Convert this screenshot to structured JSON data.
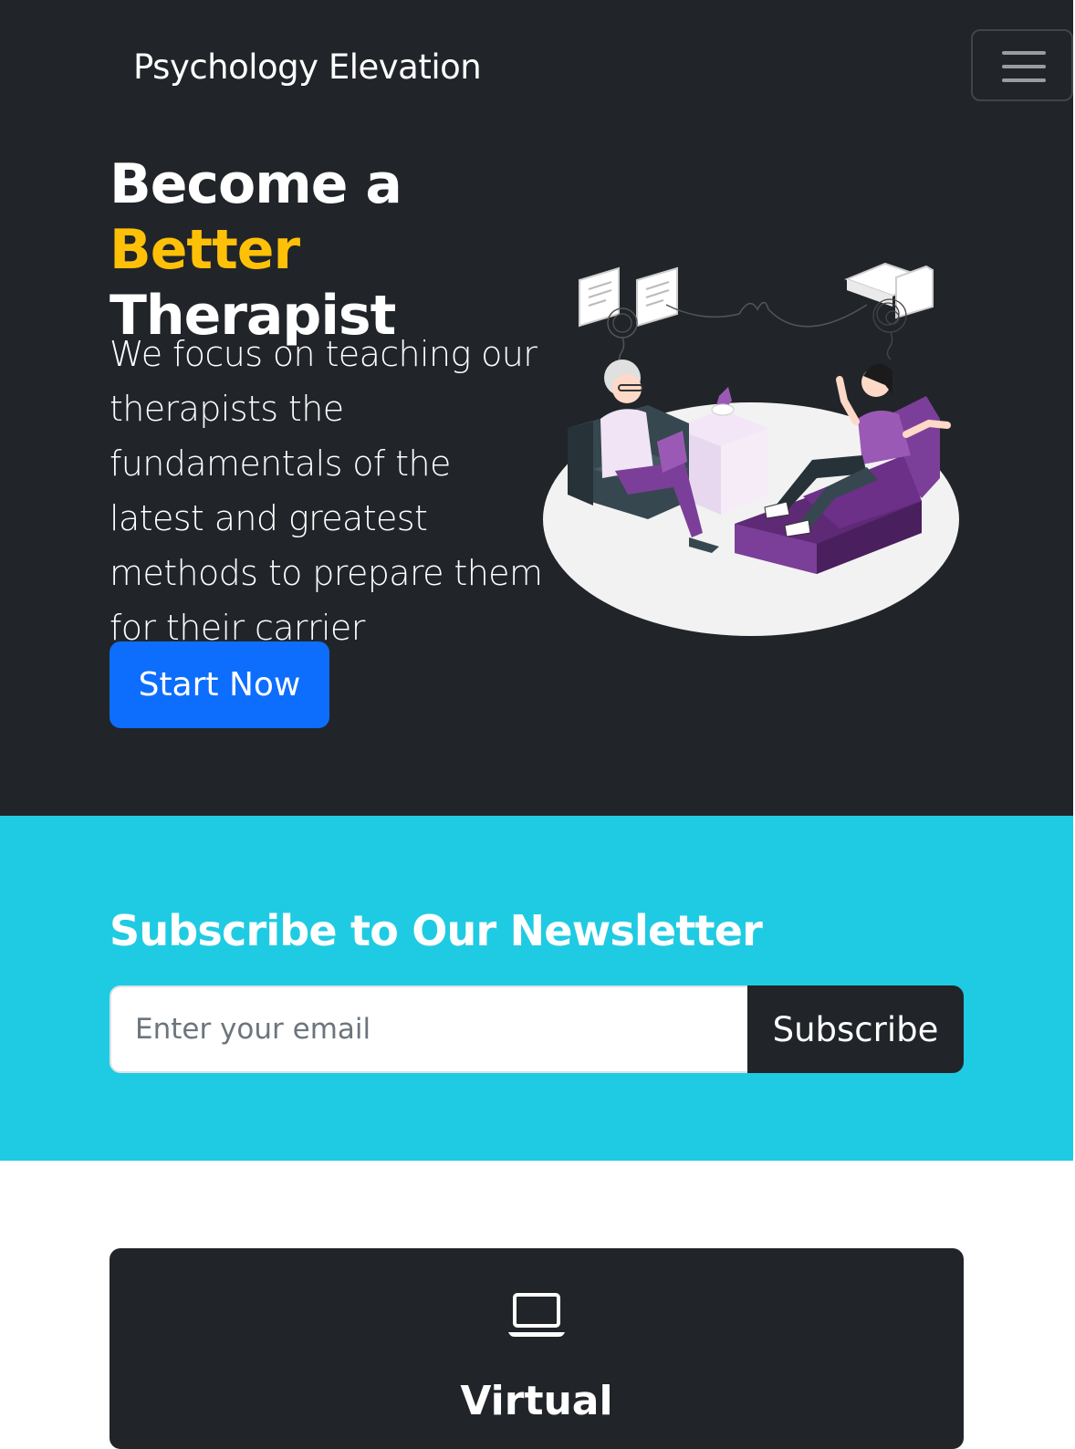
{
  "navbar": {
    "brand": "Psychology Elevation",
    "toggler_icon": "hamburger-menu-icon"
  },
  "hero": {
    "title_prefix": "Become a ",
    "title_accent": "Better",
    "title_suffix": "Therapist",
    "lead": "We focus on teaching our therapists the fundamentals of the latest and greatest methods to prepare them for their carrier",
    "cta_label": "Start Now",
    "illustration": "therapy-session-illustration",
    "accent_color": "#ffc107",
    "cta_color": "#0d6efd"
  },
  "newsletter": {
    "title": "Subscribe to Our Newsletter",
    "email_placeholder": "Enter your email",
    "button_label": "Subscribe",
    "background_color": "#1fcbe2"
  },
  "features": {
    "card_icon": "laptop-icon",
    "card_title": "Virtual"
  },
  "colors": {
    "dark": "#212529",
    "white": "#ffffff"
  }
}
